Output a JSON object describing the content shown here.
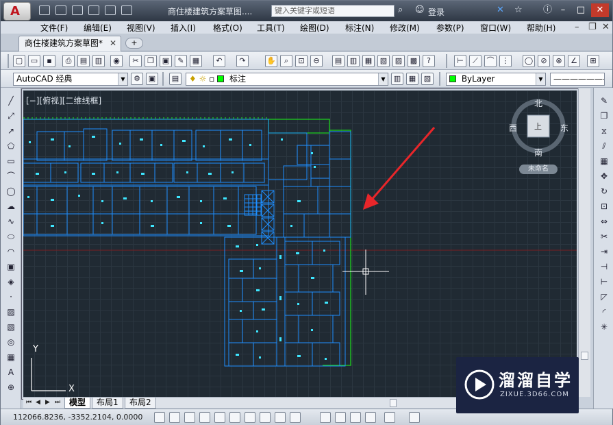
{
  "window": {
    "title": "商住楼建筑方案草图....",
    "search_placeholder": "键入关键字或短语",
    "login": "登录"
  },
  "menu": [
    "文件(F)",
    "编辑(E)",
    "视图(V)",
    "插入(I)",
    "格式(O)",
    "工具(T)",
    "绘图(D)",
    "标注(N)",
    "修改(M)",
    "参数(P)",
    "窗口(W)",
    "帮助(H)"
  ],
  "tabs": {
    "document": "商住楼建筑方案草图*"
  },
  "toolbar2": {
    "workspace": "AutoCAD 经典",
    "layer": "标注",
    "color": "ByLayer"
  },
  "viewport": {
    "label": "[−][俯视][二维线框]"
  },
  "viewcube": {
    "north": "北",
    "south": "南",
    "east": "东",
    "west": "西",
    "top_face": "上",
    "wcs": "未命名"
  },
  "ucs": {
    "x": "X",
    "y": "Y"
  },
  "layout_tabs": [
    "模型",
    "布局1",
    "布局2"
  ],
  "status": {
    "coords": "112066.8236, -3352.2104, 0.0000"
  },
  "watermark": {
    "title": "溜溜自学",
    "subtitle": "ZIXUE.3D66.COM"
  },
  "colors": {
    "canvas": "#202a33",
    "plan_blue": "#1e8fff",
    "plan_green": "#1ed21e",
    "accent_red": "#e8262a"
  }
}
